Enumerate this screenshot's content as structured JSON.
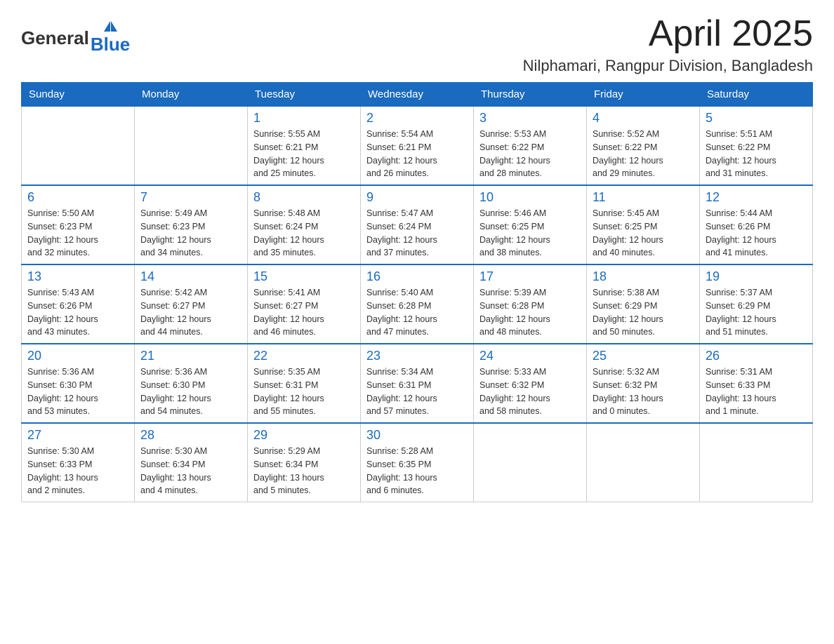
{
  "logo": {
    "general": "General",
    "blue": "Blue"
  },
  "title": {
    "month": "April 2025",
    "location": "Nilphamari, Rangpur Division, Bangladesh"
  },
  "weekdays": [
    "Sunday",
    "Monday",
    "Tuesday",
    "Wednesday",
    "Thursday",
    "Friday",
    "Saturday"
  ],
  "weeks": [
    [
      {
        "day": "",
        "info": ""
      },
      {
        "day": "",
        "info": ""
      },
      {
        "day": "1",
        "info": "Sunrise: 5:55 AM\nSunset: 6:21 PM\nDaylight: 12 hours\nand 25 minutes."
      },
      {
        "day": "2",
        "info": "Sunrise: 5:54 AM\nSunset: 6:21 PM\nDaylight: 12 hours\nand 26 minutes."
      },
      {
        "day": "3",
        "info": "Sunrise: 5:53 AM\nSunset: 6:22 PM\nDaylight: 12 hours\nand 28 minutes."
      },
      {
        "day": "4",
        "info": "Sunrise: 5:52 AM\nSunset: 6:22 PM\nDaylight: 12 hours\nand 29 minutes."
      },
      {
        "day": "5",
        "info": "Sunrise: 5:51 AM\nSunset: 6:22 PM\nDaylight: 12 hours\nand 31 minutes."
      }
    ],
    [
      {
        "day": "6",
        "info": "Sunrise: 5:50 AM\nSunset: 6:23 PM\nDaylight: 12 hours\nand 32 minutes."
      },
      {
        "day": "7",
        "info": "Sunrise: 5:49 AM\nSunset: 6:23 PM\nDaylight: 12 hours\nand 34 minutes."
      },
      {
        "day": "8",
        "info": "Sunrise: 5:48 AM\nSunset: 6:24 PM\nDaylight: 12 hours\nand 35 minutes."
      },
      {
        "day": "9",
        "info": "Sunrise: 5:47 AM\nSunset: 6:24 PM\nDaylight: 12 hours\nand 37 minutes."
      },
      {
        "day": "10",
        "info": "Sunrise: 5:46 AM\nSunset: 6:25 PM\nDaylight: 12 hours\nand 38 minutes."
      },
      {
        "day": "11",
        "info": "Sunrise: 5:45 AM\nSunset: 6:25 PM\nDaylight: 12 hours\nand 40 minutes."
      },
      {
        "day": "12",
        "info": "Sunrise: 5:44 AM\nSunset: 6:26 PM\nDaylight: 12 hours\nand 41 minutes."
      }
    ],
    [
      {
        "day": "13",
        "info": "Sunrise: 5:43 AM\nSunset: 6:26 PM\nDaylight: 12 hours\nand 43 minutes."
      },
      {
        "day": "14",
        "info": "Sunrise: 5:42 AM\nSunset: 6:27 PM\nDaylight: 12 hours\nand 44 minutes."
      },
      {
        "day": "15",
        "info": "Sunrise: 5:41 AM\nSunset: 6:27 PM\nDaylight: 12 hours\nand 46 minutes."
      },
      {
        "day": "16",
        "info": "Sunrise: 5:40 AM\nSunset: 6:28 PM\nDaylight: 12 hours\nand 47 minutes."
      },
      {
        "day": "17",
        "info": "Sunrise: 5:39 AM\nSunset: 6:28 PM\nDaylight: 12 hours\nand 48 minutes."
      },
      {
        "day": "18",
        "info": "Sunrise: 5:38 AM\nSunset: 6:29 PM\nDaylight: 12 hours\nand 50 minutes."
      },
      {
        "day": "19",
        "info": "Sunrise: 5:37 AM\nSunset: 6:29 PM\nDaylight: 12 hours\nand 51 minutes."
      }
    ],
    [
      {
        "day": "20",
        "info": "Sunrise: 5:36 AM\nSunset: 6:30 PM\nDaylight: 12 hours\nand 53 minutes."
      },
      {
        "day": "21",
        "info": "Sunrise: 5:36 AM\nSunset: 6:30 PM\nDaylight: 12 hours\nand 54 minutes."
      },
      {
        "day": "22",
        "info": "Sunrise: 5:35 AM\nSunset: 6:31 PM\nDaylight: 12 hours\nand 55 minutes."
      },
      {
        "day": "23",
        "info": "Sunrise: 5:34 AM\nSunset: 6:31 PM\nDaylight: 12 hours\nand 57 minutes."
      },
      {
        "day": "24",
        "info": "Sunrise: 5:33 AM\nSunset: 6:32 PM\nDaylight: 12 hours\nand 58 minutes."
      },
      {
        "day": "25",
        "info": "Sunrise: 5:32 AM\nSunset: 6:32 PM\nDaylight: 13 hours\nand 0 minutes."
      },
      {
        "day": "26",
        "info": "Sunrise: 5:31 AM\nSunset: 6:33 PM\nDaylight: 13 hours\nand 1 minute."
      }
    ],
    [
      {
        "day": "27",
        "info": "Sunrise: 5:30 AM\nSunset: 6:33 PM\nDaylight: 13 hours\nand 2 minutes."
      },
      {
        "day": "28",
        "info": "Sunrise: 5:30 AM\nSunset: 6:34 PM\nDaylight: 13 hours\nand 4 minutes."
      },
      {
        "day": "29",
        "info": "Sunrise: 5:29 AM\nSunset: 6:34 PM\nDaylight: 13 hours\nand 5 minutes."
      },
      {
        "day": "30",
        "info": "Sunrise: 5:28 AM\nSunset: 6:35 PM\nDaylight: 13 hours\nand 6 minutes."
      },
      {
        "day": "",
        "info": ""
      },
      {
        "day": "",
        "info": ""
      },
      {
        "day": "",
        "info": ""
      }
    ]
  ]
}
